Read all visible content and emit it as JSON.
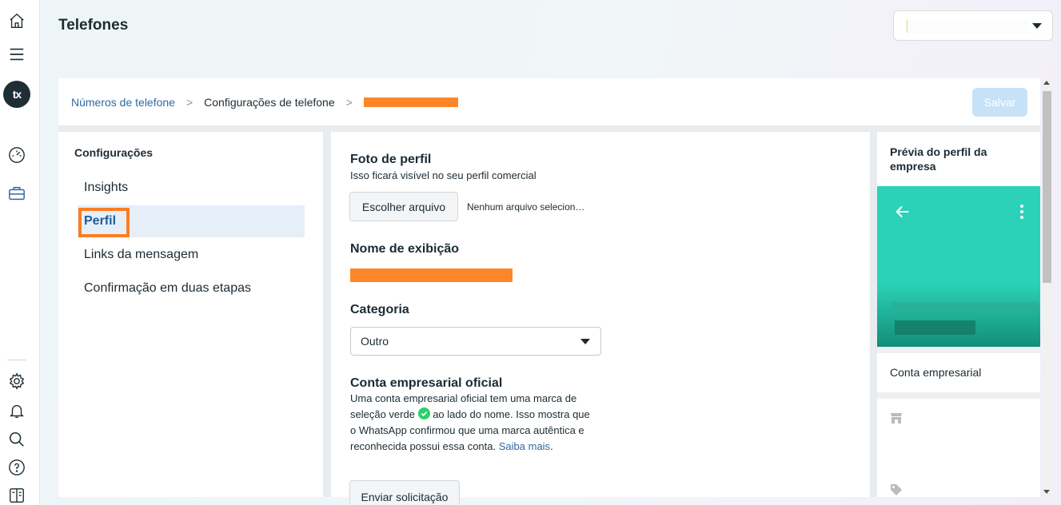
{
  "rail": {
    "avatar_text": "tx",
    "icons": [
      "home-icon",
      "menu-icon",
      "dashboard-icon",
      "briefcase-icon",
      "settings-icon",
      "bell-icon",
      "search-icon",
      "help-icon",
      "book-icon"
    ]
  },
  "header": {
    "title": "Telefones",
    "account_select": {
      "value": ""
    }
  },
  "breadcrumb": {
    "items": [
      "Números de telefone",
      "Configurações de telefone"
    ],
    "separator": ">"
  },
  "toolbar": {
    "save_label": "Salvar"
  },
  "nav": {
    "title": "Configurações",
    "items": [
      {
        "label": "Insights",
        "active": false
      },
      {
        "label": "Perfil",
        "active": true
      },
      {
        "label": "Links da mensagem",
        "active": false
      },
      {
        "label": "Confirmação em duas etapas",
        "active": false
      }
    ]
  },
  "profile": {
    "photo": {
      "title": "Foto de perfil",
      "subtitle": "Isso ficará visível no seu perfil comercial",
      "choose_file_label": "Escolher arquivo",
      "file_status": "Nenhum arquivo selecionado"
    },
    "display_name": {
      "title": "Nome de exibição"
    },
    "category": {
      "title": "Categoria",
      "value": "Outro"
    },
    "official_account": {
      "title": "Conta empresarial oficial",
      "text_before": "Uma conta empresarial oficial tem uma marca de seleção verde",
      "text_after": "ao lado do nome. Isso mostra que o WhatsApp confirmou que uma marca autêntica e reconhecida possui essa conta.",
      "link_label": "Saiba mais",
      "link_suffix": ".",
      "request_label": "Enviar solicitação"
    }
  },
  "preview": {
    "title": "Prévia do perfil da empresa",
    "account_type": "Conta empresarial"
  },
  "colors": {
    "accent": "#2f6aa3",
    "redaction": "#fd8728",
    "preview_header": "#2bd2b7",
    "verified": "#25d366"
  }
}
